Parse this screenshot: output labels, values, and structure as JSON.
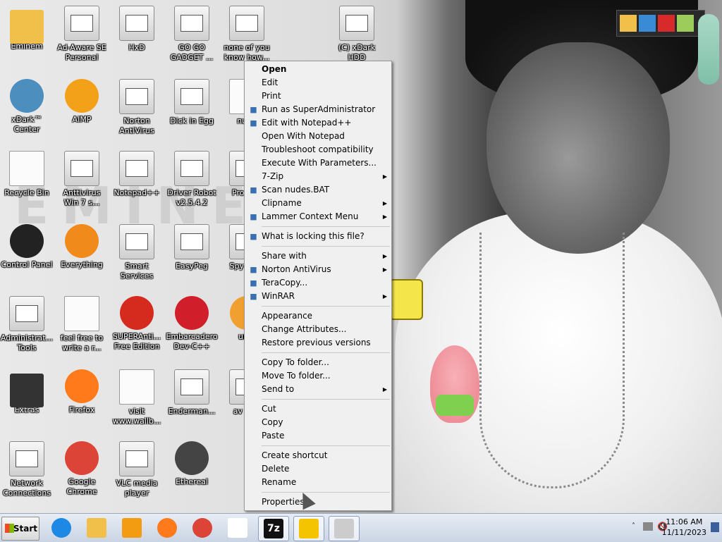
{
  "wallpaper": {
    "text": "EMINEM"
  },
  "desktop_icons": [
    {
      "label": "Eminem",
      "icon": "user-folder-icon",
      "kind": "folder",
      "color": "#f0c04a"
    },
    {
      "label": "Ad-Aware SE Personal",
      "icon": "app-window-icon",
      "kind": "app"
    },
    {
      "label": "HxD",
      "icon": "hex-editor-icon",
      "kind": "app"
    },
    {
      "label": "GO GO GADGET ...",
      "icon": "gadget-icon",
      "kind": "app"
    },
    {
      "label": "none of you know how...",
      "icon": "shortcut-icon",
      "kind": "app"
    },
    {
      "label": "(C) xDark HDD",
      "icon": "hdd-icon",
      "kind": "app"
    },
    {
      "label": "xDark™ Center",
      "icon": "xdark-center-icon",
      "kind": "circle",
      "color": "#4c8fbf"
    },
    {
      "label": "AIMP",
      "icon": "aimp-icon",
      "kind": "circle",
      "color": "#f4a11a"
    },
    {
      "label": "Norton AntiVirus",
      "icon": "norton-icon",
      "kind": "app"
    },
    {
      "label": "Dick in Egg",
      "icon": "notepad-icon",
      "kind": "app"
    },
    {
      "label": "nude",
      "icon": "batch-file-icon",
      "kind": "doc"
    },
    {
      "label": "Recycle Bin",
      "icon": "recycle-bin-icon",
      "kind": "doc"
    },
    {
      "label": "Anttivirus Win 7 s...",
      "icon": "app-window-icon",
      "kind": "app"
    },
    {
      "label": "Notepad++",
      "icon": "notepad-plus-icon",
      "kind": "app"
    },
    {
      "label": "Driver Robot v2.5.4.2",
      "icon": "driver-robot-icon",
      "kind": "app"
    },
    {
      "label": "Pro Hac",
      "icon": "app-window-icon",
      "kind": "app"
    },
    {
      "label": "Control Panel",
      "icon": "control-panel-icon",
      "kind": "circle",
      "color": "#222222"
    },
    {
      "label": "Everything",
      "icon": "everything-search-icon",
      "kind": "circle",
      "color": "#f08a1a"
    },
    {
      "label": "Smart Services",
      "icon": "gear-icon",
      "kind": "app"
    },
    {
      "label": "EasyPeg",
      "icon": "easypeg-icon",
      "kind": "app"
    },
    {
      "label": "Spy Sear",
      "icon": "app-window-icon",
      "kind": "app"
    },
    {
      "label": "Administrat... Tools",
      "icon": "admin-tools-icon",
      "kind": "app"
    },
    {
      "label": "feel free to write a r...",
      "icon": "text-file-icon",
      "kind": "doc"
    },
    {
      "label": "SUPERAnti... Free Edition",
      "icon": "superantispyware-icon",
      "kind": "circle",
      "color": "#d52b1e"
    },
    {
      "label": "Embarcadero Dev-C++",
      "icon": "devcpp-icon",
      "kind": "circle",
      "color": "#d01f2a"
    },
    {
      "label": "unin",
      "icon": "uninstall-icon",
      "kind": "circle",
      "color": "#f0a030"
    },
    {
      "label": "Extras",
      "icon": "folder-icon",
      "kind": "folder",
      "color": "#333333"
    },
    {
      "label": "Firefox",
      "icon": "firefox-icon",
      "kind": "circle",
      "color": "#ff7a1a"
    },
    {
      "label": "visit www.wallb...",
      "icon": "text-file-icon",
      "kind": "doc"
    },
    {
      "label": "Enderman...",
      "icon": "app-window-icon",
      "kind": "app"
    },
    {
      "label": "av Anti",
      "icon": "app-window-icon",
      "kind": "app"
    },
    {
      "label": "Network Connections",
      "icon": "network-icon",
      "kind": "app"
    },
    {
      "label": "Google Chrome",
      "icon": "chrome-icon",
      "kind": "circle",
      "color": "#db4437"
    },
    {
      "label": "VLC media player",
      "icon": "vlc-icon",
      "kind": "app"
    },
    {
      "label": "Ethereal",
      "icon": "ethereal-icon",
      "kind": "circle",
      "color": "#444444"
    }
  ],
  "context_menu": {
    "groups": [
      [
        {
          "label": "Open",
          "bold": true
        },
        {
          "label": "Edit"
        },
        {
          "label": "Print"
        },
        {
          "label": "Run as SuperAdministrator",
          "icon": "shield-icon"
        },
        {
          "label": "Edit with Notepad++",
          "icon": "notepad-plus-icon"
        },
        {
          "label": "Open With Notepad"
        },
        {
          "label": "Troubleshoot compatibility"
        },
        {
          "label": "Execute With Parameters..."
        },
        {
          "label": "7-Zip",
          "submenu": true
        },
        {
          "label": "Scan nudes.BAT",
          "icon": "scan-icon"
        },
        {
          "label": "Clipname",
          "submenu": true
        },
        {
          "label": "Lammer Context Menu",
          "icon": "lammer-icon",
          "submenu": true
        }
      ],
      [
        {
          "label": "What is locking this file?",
          "icon": "lock-search-icon"
        }
      ],
      [
        {
          "label": "Share with",
          "submenu": true
        },
        {
          "label": "Norton AntiVirus",
          "icon": "norton-icon",
          "submenu": true
        },
        {
          "label": "TeraCopy...",
          "icon": "teracopy-icon"
        },
        {
          "label": "WinRAR",
          "icon": "winrar-icon",
          "submenu": true
        }
      ],
      [
        {
          "label": "Appearance"
        },
        {
          "label": "Change Attributes..."
        },
        {
          "label": "Restore previous versions"
        }
      ],
      [
        {
          "label": "Copy To folder..."
        },
        {
          "label": "Move To folder..."
        },
        {
          "label": "Send to",
          "submenu": true
        }
      ],
      [
        {
          "label": "Cut"
        },
        {
          "label": "Copy"
        },
        {
          "label": "Paste"
        }
      ],
      [
        {
          "label": "Create shortcut"
        },
        {
          "label": "Delete"
        },
        {
          "label": "Rename"
        }
      ],
      [
        {
          "label": "Properties"
        }
      ]
    ]
  },
  "taskbar": {
    "start_label": "Start",
    "pinned": [
      {
        "name": "internet-explorer",
        "icon": "internet-explorer-icon",
        "color": "#1e88e5"
      },
      {
        "name": "explorer",
        "icon": "folder-icon",
        "color": "#f0c04a"
      },
      {
        "name": "media-player",
        "icon": "media-player-icon",
        "color": "#f39c12"
      },
      {
        "name": "firefox",
        "icon": "firefox-icon",
        "color": "#ff7a1a"
      },
      {
        "name": "chrome",
        "icon": "chrome-icon",
        "color": "#db4437"
      },
      {
        "name": "folder-window",
        "icon": "window-icon",
        "color": "#ffffff"
      },
      {
        "name": "7zip",
        "icon": "7zip-icon",
        "color": "#111111",
        "text": "7z"
      },
      {
        "name": "norton",
        "icon": "norton-icon",
        "color": "#f5c400"
      },
      {
        "name": "app-window",
        "icon": "app-window-icon",
        "color": "#cccccc"
      }
    ],
    "clock": {
      "time": "11:06 AM",
      "date": "11/11/2023"
    }
  },
  "colors": {
    "menu_bg": "#f0f0f0",
    "taskbar_top": "#e8edf5",
    "taskbar_bottom": "#c9d4e4"
  }
}
